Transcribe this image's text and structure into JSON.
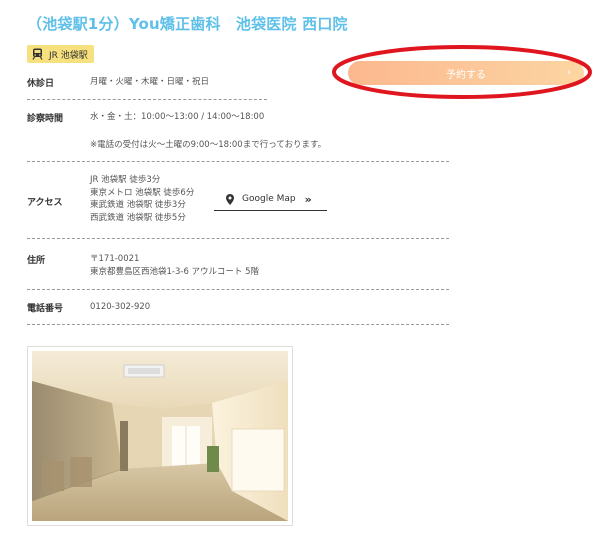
{
  "header": {
    "title": "（池袋駅1分）You矯正歯科　池袋医院 西口院",
    "station_badge": "JR 池袋駅"
  },
  "reserve": {
    "label": "予約する",
    "chevron": "›"
  },
  "info": {
    "closed": {
      "label": "休診日",
      "value": "月曜・火曜・木曜・日曜・祝日"
    },
    "hours": {
      "label": "診察時間",
      "value": "水・金・土：10:00～13:00 / 14:00～18:00",
      "note": "※電話の受付は火～土曜の9:00～18:00まで行っております。"
    },
    "access": {
      "label": "アクセス",
      "lines": [
        "JR 池袋駅 徒歩3分",
        "東京メトロ 池袋駅 徒歩6分",
        "東武鉄道 池袋駅 徒歩3分",
        "西武鉄道 池袋駅 徒歩5分"
      ],
      "map_link": "Google Map",
      "map_arrow": "»"
    },
    "address": {
      "label": "住所",
      "postal": "〒171-0021",
      "street": "東京都豊島区西池袋1-3-6 アウルコート 5階"
    },
    "phone": {
      "label": "電話番号",
      "value": "0120-302-920"
    }
  },
  "colors": {
    "title": "#5fc0e9",
    "badge": "#f7e07e",
    "button_from": "#fcb88f",
    "button_to": "#fdd6a2",
    "annotation": "#e0161f"
  },
  "icons": {
    "badge": "train-icon",
    "map": "map-pin-icon"
  }
}
